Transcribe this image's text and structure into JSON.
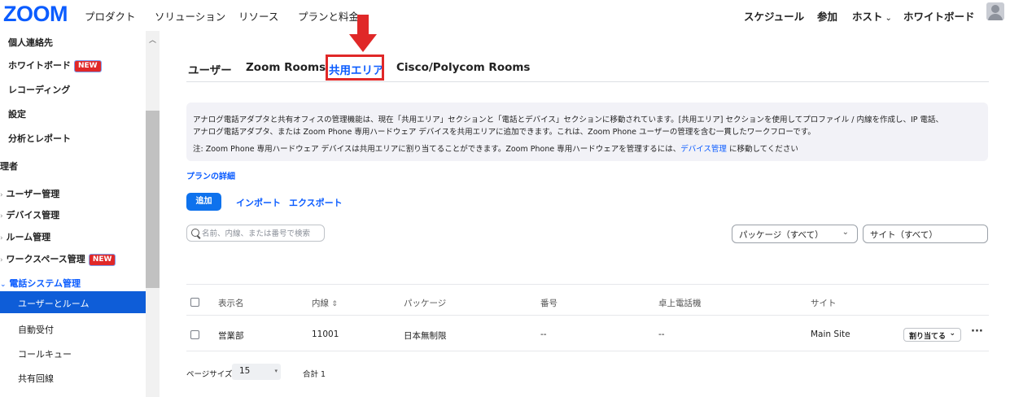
{
  "brand": {
    "logo": "ZOOM",
    "accent": "#0b5cff",
    "highlight": "#e02828"
  },
  "topnav": {
    "left": [
      "プロダクト",
      "ソリューション",
      "リソース",
      "プランと料金"
    ],
    "schedule": "スケジュール",
    "join": "参加",
    "host": "ホスト",
    "whiteboard": "ホワイトボード"
  },
  "sidebar": {
    "contacts": "個人連絡先",
    "whiteboard": "ホワイトボード",
    "whiteboard_badge": "NEW",
    "recording": "レコーディング",
    "settings": "設定",
    "reports": "分析とレポート",
    "admin": "理者",
    "user_mgmt": "ユーザー管理",
    "device_mgmt": "デバイス管理",
    "room_mgmt": "ルーム管理",
    "workspace_mgmt": "ワークスペース管理",
    "workspace_badge": "NEW",
    "phone_mgmt": "電話システム管理",
    "users_rooms": "ユーザーとルーム",
    "auto_receptionist": "自動受付",
    "call_queue": "コールキュー",
    "shared_lines": "共有回線"
  },
  "tabs": {
    "users": "ユーザー",
    "zoom_rooms": "Zoom Rooms",
    "common_areas": "共用エリア",
    "cisco": "Cisco/Polycom Rooms"
  },
  "notice": {
    "line1": "アナログ電話アダプタと共有オフィスの管理機能は、現在「共用エリア」セクションと「電話とデバイス」セクションに移動されています。[共用エリア] セクションを使用してプロファイル / 内線を作成し、IP 電話、",
    "line2": "アナログ電話アダプタ、または Zoom Phone 専用ハードウェア デバイスを共用エリアに追加できます。これは、Zoom Phone ユーザーの管理を含む一貫したワークフローです。",
    "line3_pre": "注: Zoom Phone 専用ハードウェア デバイスは共用エリアに割り当てることができます。Zoom Phone 専用ハードウェアを管理するには、",
    "line3_link": "デバイス管理",
    "line3_post": " に移動してください"
  },
  "plan_link": "プランの詳細",
  "actions": {
    "add": "追加",
    "import": "インポート",
    "export": "エクスポート"
  },
  "search": {
    "placeholder": "名前、内線、または番号で検索",
    "value": ""
  },
  "filters": {
    "package": "パッケージ（すべて）",
    "site": "サイト（すべて）"
  },
  "table": {
    "headers": [
      "表示名",
      "内線",
      "パッケージ",
      "番号",
      "卓上電話機",
      "サイト"
    ],
    "rows": [
      {
        "name": "営業部",
        "ext": "11001",
        "package": "日本無制限",
        "number": "--",
        "desk_phone": "--",
        "site": "Main Site",
        "assign": "割り当てる"
      }
    ]
  },
  "pagination": {
    "label": "ページサイズ",
    "size": "15",
    "total": "合計 1"
  }
}
